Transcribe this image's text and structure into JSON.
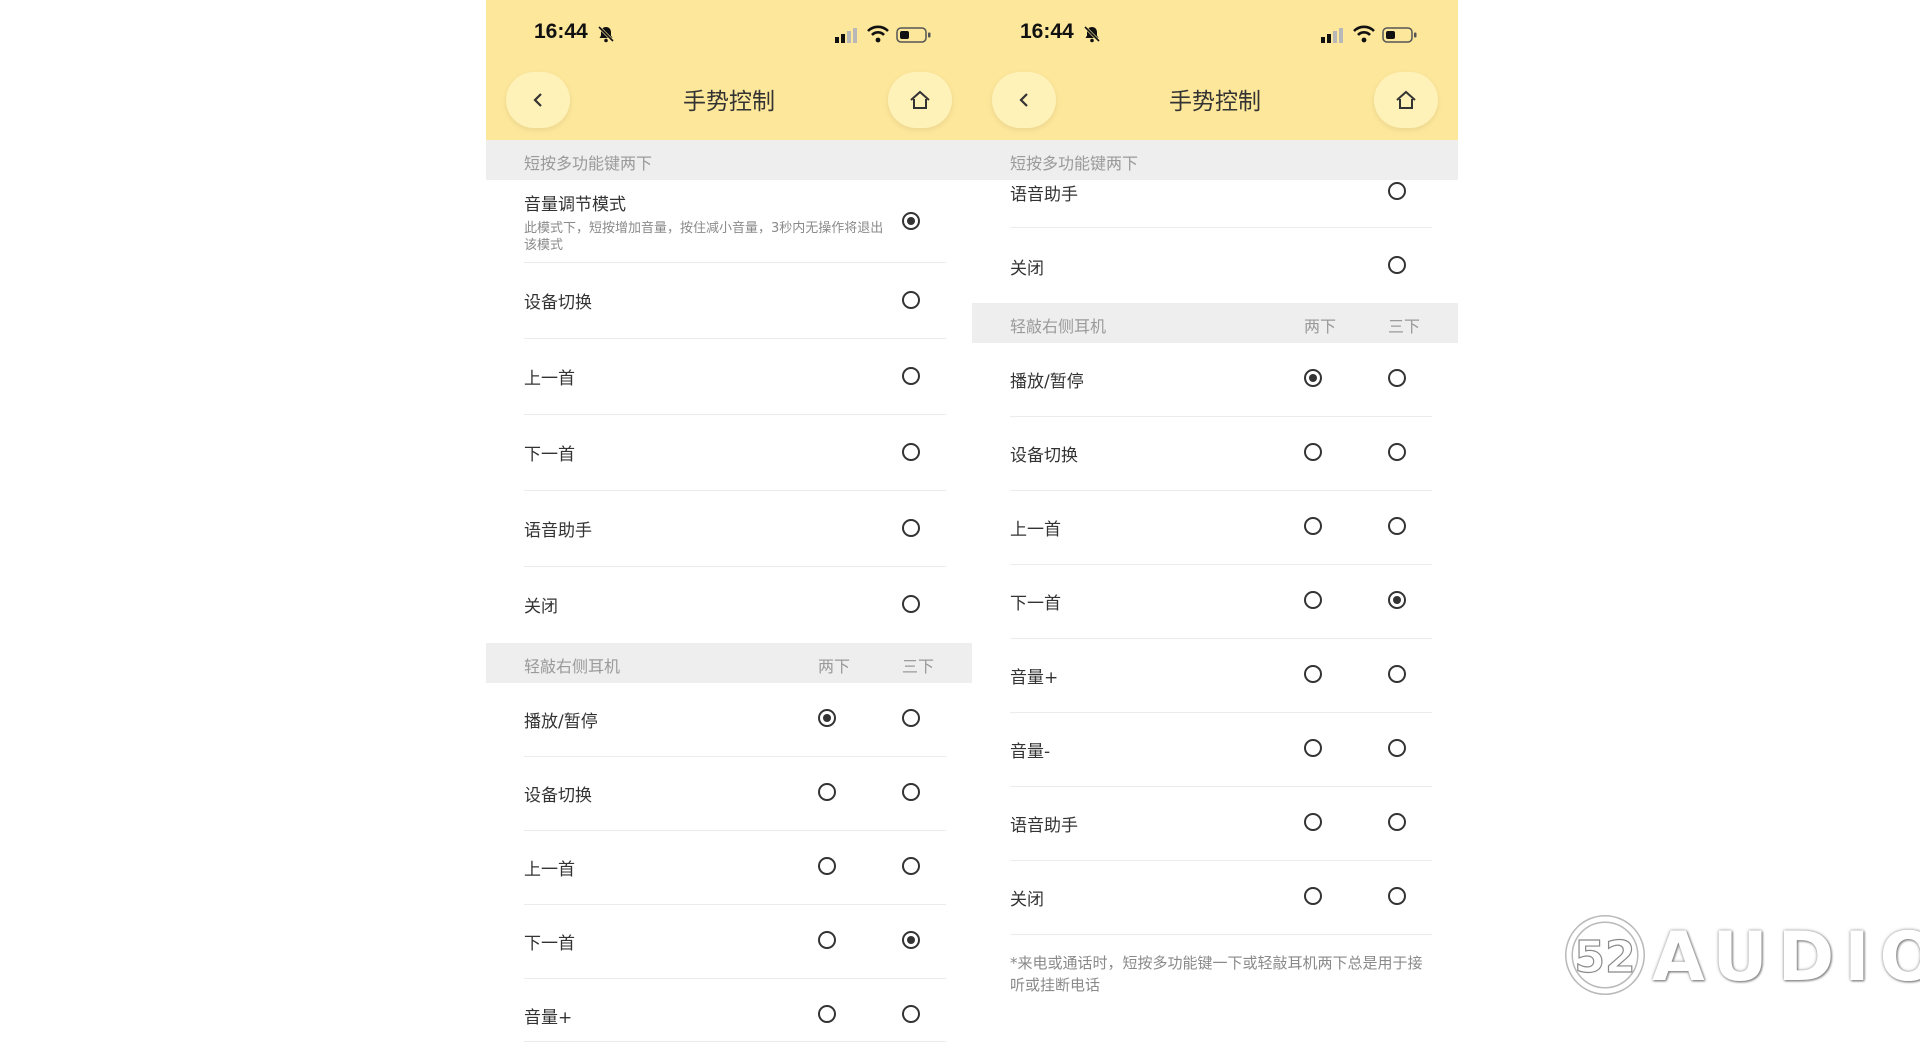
{
  "status": {
    "time": "16:44"
  },
  "nav": {
    "title": "手势控制"
  },
  "col_labels": {
    "double": "两下",
    "triple": "三下"
  },
  "left": {
    "section1": {
      "title": "短按多功能键两下",
      "items": [
        {
          "label": "音量调节模式",
          "desc": "此模式下，短按增加音量，按住减小音量，3秒内无操作将退出该模式",
          "selected": true
        },
        {
          "label": "设备切换",
          "selected": false
        },
        {
          "label": "上一首",
          "selected": false
        },
        {
          "label": "下一首",
          "selected": false
        },
        {
          "label": "语音助手",
          "selected": false
        },
        {
          "label": "关闭",
          "selected": false
        }
      ]
    },
    "section2": {
      "title": "轻敲右侧耳机",
      "items": [
        {
          "label": "播放/暂停",
          "double": true,
          "triple": false
        },
        {
          "label": "设备切换",
          "double": false,
          "triple": false
        },
        {
          "label": "上一首",
          "double": false,
          "triple": false
        },
        {
          "label": "下一首",
          "double": false,
          "triple": true
        },
        {
          "label": "音量+",
          "double": false,
          "triple": false
        }
      ]
    }
  },
  "right": {
    "section1": {
      "title": "短按多功能键两下",
      "items": [
        {
          "label": "语音助手",
          "selected": false
        },
        {
          "label": "关闭",
          "selected": false
        }
      ]
    },
    "section2": {
      "title": "轻敲右侧耳机",
      "items": [
        {
          "label": "播放/暂停",
          "double": true,
          "triple": false
        },
        {
          "label": "设备切换",
          "double": false,
          "triple": false
        },
        {
          "label": "上一首",
          "double": false,
          "triple": false
        },
        {
          "label": "下一首",
          "double": false,
          "triple": true
        },
        {
          "label": "音量+",
          "double": false,
          "triple": false
        },
        {
          "label": "音量-",
          "double": false,
          "triple": false
        },
        {
          "label": "语音助手",
          "double": false,
          "triple": false
        },
        {
          "label": "关闭",
          "double": false,
          "triple": false
        }
      ]
    },
    "footnote": "*来电或通话时，短按多功能键一下或轻敲耳机两下总是用于接听或挂断电话"
  },
  "watermark": {
    "text": "AUDIO",
    "badge": "52"
  },
  "colors": {
    "header_bg": "#fde79b",
    "nav_button_bg": "#fff2b8",
    "section_bg": "#eeeeee"
  }
}
